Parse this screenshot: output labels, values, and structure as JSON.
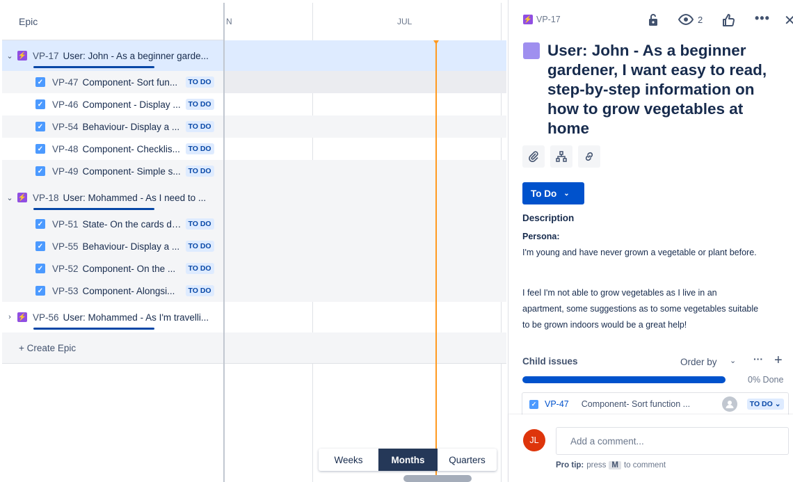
{
  "epic_list": {
    "header": "Epic",
    "epics": [
      {
        "key": "VP-17",
        "summary": "User: John - As a beginner garde...",
        "expanded": true,
        "children": [
          {
            "key": "VP-47",
            "summary": "Component- Sort fun...",
            "status": "TO DO"
          },
          {
            "key": "VP-46",
            "summary": "Component - Display ...",
            "status": "TO DO"
          },
          {
            "key": "VP-54",
            "summary": "Behaviour- Display a ...",
            "status": "TO DO"
          },
          {
            "key": "VP-48",
            "summary": "Component- Checklis...",
            "status": "TO DO"
          },
          {
            "key": "VP-49",
            "summary": "Component- Simple s...",
            "status": "TO DO"
          }
        ]
      },
      {
        "key": "VP-18",
        "summary": "User: Mohammed - As I need to ...",
        "expanded": true,
        "children": [
          {
            "key": "VP-51",
            "summary": "State- On the cards di...",
            "status": "TO DO"
          },
          {
            "key": "VP-55",
            "summary": "Behaviour- Display a ...",
            "status": "TO DO"
          },
          {
            "key": "VP-52",
            "summary": "Component- On the ...",
            "status": "TO DO"
          },
          {
            "key": "VP-53",
            "summary": "Component- Alongsi...",
            "status": "TO DO"
          }
        ]
      },
      {
        "key": "VP-56",
        "summary": "User: Mohammed - As I'm travelli...",
        "expanded": false,
        "children": []
      }
    ],
    "create_epic": "+ Create Epic"
  },
  "timeline": {
    "months": [
      "N",
      "JUL"
    ],
    "today_color": "#ff991f",
    "view_modes": {
      "weeks": "Weeks",
      "months": "Months",
      "quarters": "Quarters",
      "selected": "Months"
    }
  },
  "issue_panel": {
    "key": "VP-17",
    "watchers": "2",
    "title": "User: John - As a beginner gardener, I want easy to read, step-by-step information on how to grow vegetables at home",
    "status_button": "To Do",
    "description_label": "Description",
    "persona_label": "Persona:",
    "paragraph1": "I'm young and have never grown a vegetable or plant before.",
    "paragraph2": "I feel I'm not able to grow vegetables as I live in an apartment, some suggestions as to some vegetables suitable to be grown indoors would be a great help!",
    "child_issues": {
      "label": "Child issues",
      "order_by": "Order by",
      "progress_pct": 0,
      "done_text": "0% Done",
      "items": [
        {
          "key": "VP-47",
          "summary": "Component- Sort function ...",
          "status": "TO DO"
        }
      ]
    },
    "comment": {
      "avatar_initials": "JL",
      "placeholder": "Add a comment...",
      "pro_tip_label": "Pro tip:",
      "pro_tip_press": "press",
      "pro_tip_key": "M",
      "pro_tip_rest": "to comment"
    }
  },
  "colors": {
    "accent": "#0052cc",
    "epic_purple": "#904ee2",
    "checkbox_blue": "#4c9aff",
    "selected_row": "#deebff",
    "today_line": "#ff991f"
  }
}
